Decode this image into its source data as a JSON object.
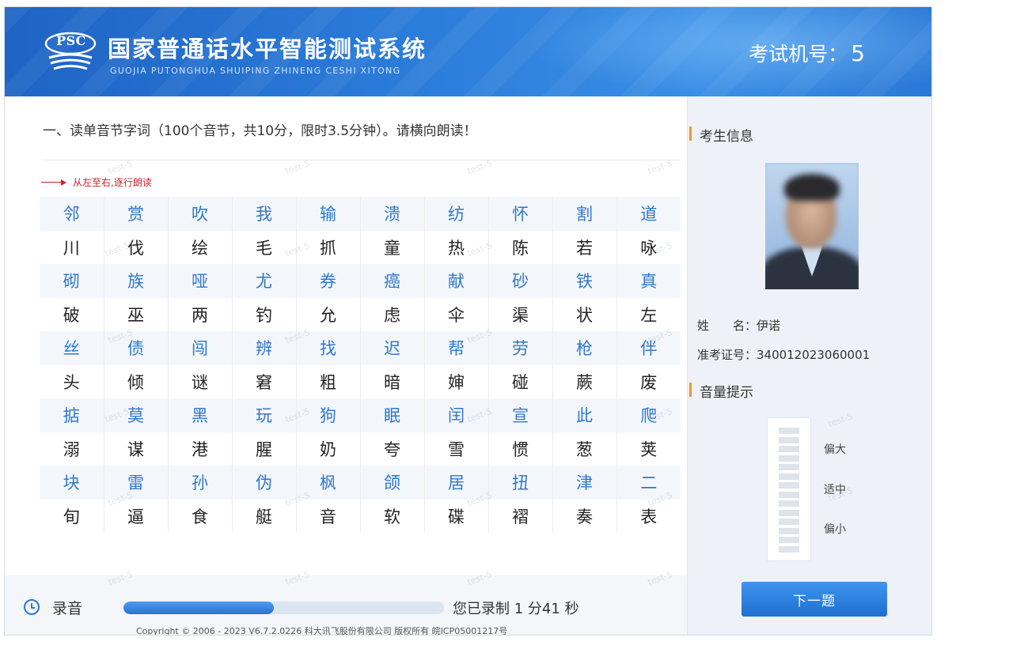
{
  "header": {
    "logo_text": "PSC",
    "title": "国家普通话水平智能测试系统",
    "subtitle": "GUOJIA PUTONGHUA SHUIPING ZHINENG CESHI XITONG",
    "machine_label": "考试机号：",
    "machine_number": "5"
  },
  "main": {
    "instruction": "一、读单音节字词（100个音节，共10分，限时3.5分钟）。请横向朗读！",
    "hint": "从左至右,逐行朗读",
    "rows": [
      [
        "邻",
        "赏",
        "吹",
        "我",
        "输",
        "溃",
        "纺",
        "怀",
        "割",
        "道"
      ],
      [
        "川",
        "伐",
        "绘",
        "毛",
        "抓",
        "童",
        "热",
        "陈",
        "若",
        "咏"
      ],
      [
        "砌",
        "族",
        "哑",
        "尤",
        "券",
        "癌",
        "献",
        "砂",
        "铁",
        "真"
      ],
      [
        "破",
        "巫",
        "两",
        "钓",
        "允",
        "虑",
        "伞",
        "渠",
        "状",
        "左"
      ],
      [
        "丝",
        "债",
        "闯",
        "辨",
        "找",
        "迟",
        "帮",
        "劳",
        "枪",
        "伴"
      ],
      [
        "头",
        "倾",
        "谜",
        "窘",
        "粗",
        "暗",
        "婶",
        "碰",
        "蕨",
        "废"
      ],
      [
        "掂",
        "莫",
        "黑",
        "玩",
        "狗",
        "眠",
        "闰",
        "宣",
        "此",
        "爬"
      ],
      [
        "溺",
        "谋",
        "港",
        "腥",
        "奶",
        "夸",
        "雪",
        "惯",
        "葱",
        "荚"
      ],
      [
        "块",
        "雷",
        "孙",
        "伪",
        "枫",
        "颌",
        "居",
        "扭",
        "津",
        "二"
      ],
      [
        "旬",
        "逼",
        "食",
        "艇",
        "音",
        "软",
        "碟",
        "褶",
        "奏",
        "表"
      ]
    ]
  },
  "recording": {
    "label": "录音",
    "progress": 0.47,
    "status_prefix": "您已录制",
    "minutes": "1",
    "minutes_unit": "分",
    "seconds": "41",
    "seconds_unit": "秒"
  },
  "footer": {
    "copyright": "Copyright © 2006 - 2023 V6.7.2.0226 科大讯飞股份有限公司 版权所有 皖ICP05001217号"
  },
  "sidebar": {
    "info_title": "考生信息",
    "name_label": "姓　　名：",
    "name_value": "伊诺",
    "id_label": "准考证号：",
    "id_value": "340012023060001",
    "volume_title": "音量提示",
    "volume_high": "偏大",
    "volume_mid": "适中",
    "volume_low": "偏小",
    "next_button": "下一题"
  },
  "watermark_text": "test-5",
  "colors": {
    "header_blue": "#2a7ad8",
    "accent_blue": "#3077c9",
    "hint_red": "#c8222b",
    "section_orange": "#f0962b"
  }
}
